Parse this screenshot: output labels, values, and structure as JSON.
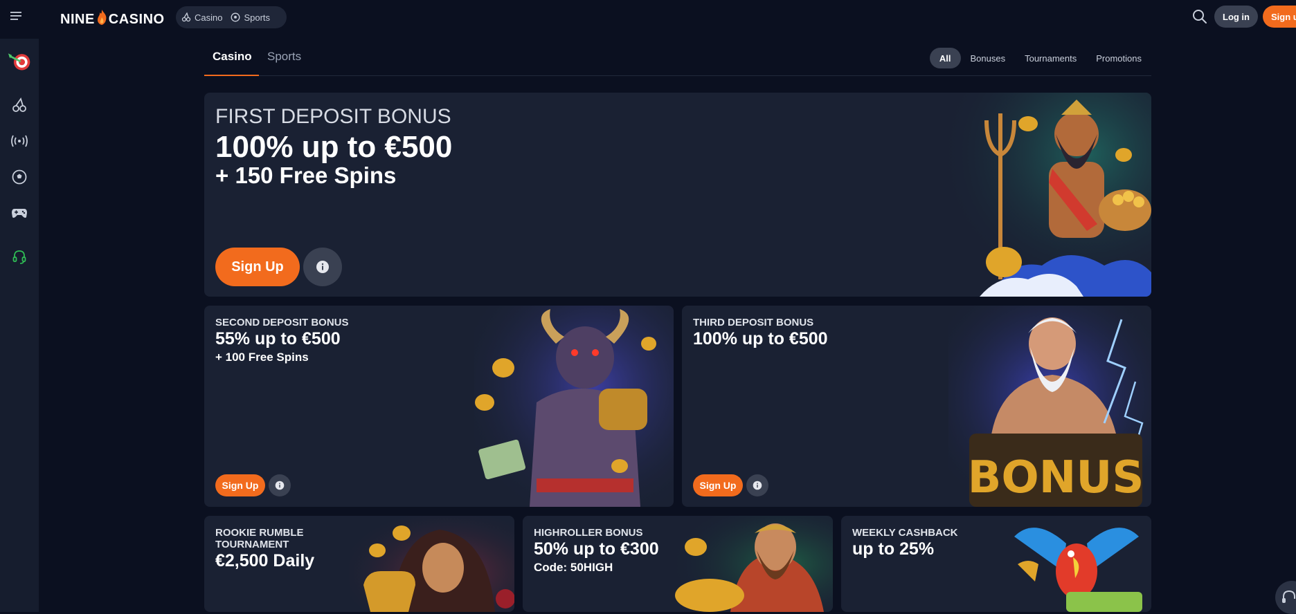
{
  "header": {
    "logo_left": "NINE",
    "logo_right": "CASINO",
    "nav": [
      {
        "label": "Casino",
        "icon": "cherry-icon"
      },
      {
        "label": "Sports",
        "icon": "soccer-ball-icon"
      }
    ],
    "login_label": "Log in",
    "signup_label": "Sign up"
  },
  "sidebar": {
    "items": [
      {
        "name": "sidebar-item-promotions",
        "icon": "target-dart-icon"
      },
      {
        "name": "sidebar-item-casino",
        "icon": "cherry-icon"
      },
      {
        "name": "sidebar-item-live",
        "icon": "broadcast-icon"
      },
      {
        "name": "sidebar-item-sports",
        "icon": "soccer-ball-icon"
      },
      {
        "name": "sidebar-item-games",
        "icon": "gamepad-icon"
      },
      {
        "name": "sidebar-item-support",
        "icon": "headset-icon"
      }
    ]
  },
  "tabs": [
    {
      "label": "Casino",
      "active": true
    },
    {
      "label": "Sports",
      "active": false
    }
  ],
  "filters": [
    {
      "label": "All",
      "active": true
    },
    {
      "label": "Bonuses",
      "active": false
    },
    {
      "label": "Tournaments",
      "active": false
    },
    {
      "label": "Promotions",
      "active": false
    }
  ],
  "hero": {
    "label": "FIRST DEPOSIT BONUS",
    "headline": "100% up to €500",
    "subline": "+ 150 Free Spins",
    "signup_label": "Sign Up"
  },
  "cards": {
    "second": {
      "label": "SECOND DEPOSIT BONUS",
      "headline": "55% up to €500",
      "subline": "+ 100 Free Spins",
      "signup_label": "Sign Up"
    },
    "third": {
      "label": "THIRD DEPOSIT BONUS",
      "headline": "100% up to €500",
      "signup_label": "Sign Up",
      "art_text": "BONUS"
    },
    "rookie": {
      "label_1": "ROOKIE RUMBLE",
      "label_2": "TOURNAMENT",
      "headline": "€2,500 Daily"
    },
    "highroller": {
      "label": "HIGHROLLER BONUS",
      "headline": "50% up to €300",
      "subline": "Code: 50HIGH"
    },
    "weekly": {
      "label": "WEEKLY CASHBACK",
      "headline": "up to 25%"
    }
  },
  "colors": {
    "accent": "#f26b1d",
    "background": "#0b1020",
    "card": "#1a2133",
    "sidebar": "#161d2e"
  }
}
